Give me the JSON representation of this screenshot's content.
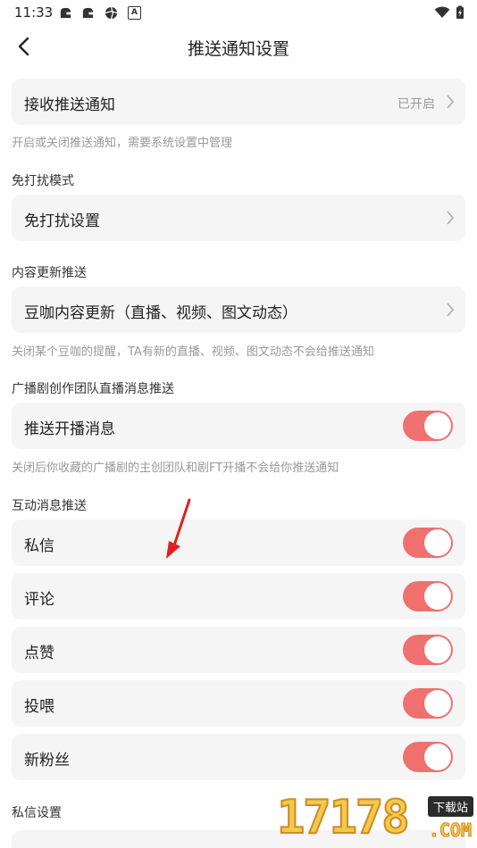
{
  "status_bar": {
    "time": "11:33",
    "notif_app_badge": "A"
  },
  "header": {
    "title": "推送通知设置"
  },
  "receive_push": {
    "label": "接收推送通知",
    "status": "已开启",
    "hint": "开启或关闭推送通知，需要系统设置中管理"
  },
  "dnd": {
    "section_title": "免打扰模式",
    "label": "免打扰设置"
  },
  "content_update": {
    "section_title": "内容更新推送",
    "label": "豆咖内容更新（直播、视频、图文动态）",
    "hint": "关闭某个豆咖的提醒，TA有新的直播、视频、图文动态不会给推送通知"
  },
  "radio_drama": {
    "section_title": "广播剧创作团队直播消息推送",
    "label": "推送开播消息",
    "enabled": true,
    "hint": "关闭后你收藏的广播剧的主创团队和剧FT开播不会给你推送通知"
  },
  "interaction": {
    "section_title": "互动消息推送",
    "items": [
      {
        "label": "私信",
        "enabled": true
      },
      {
        "label": "评论",
        "enabled": true
      },
      {
        "label": "点赞",
        "enabled": true
      },
      {
        "label": "投喂",
        "enabled": true
      },
      {
        "label": "新粉丝",
        "enabled": true
      }
    ]
  },
  "private_msg": {
    "section_title": "私信设置"
  },
  "watermark": {
    "digits": "17178",
    "tag": "下载站",
    "domain": ".COM"
  },
  "colors": {
    "toggle_on": "#f07070",
    "card_bg": "#f5f5f5",
    "hint_text": "#999999",
    "annotation_arrow": "#e02020"
  }
}
